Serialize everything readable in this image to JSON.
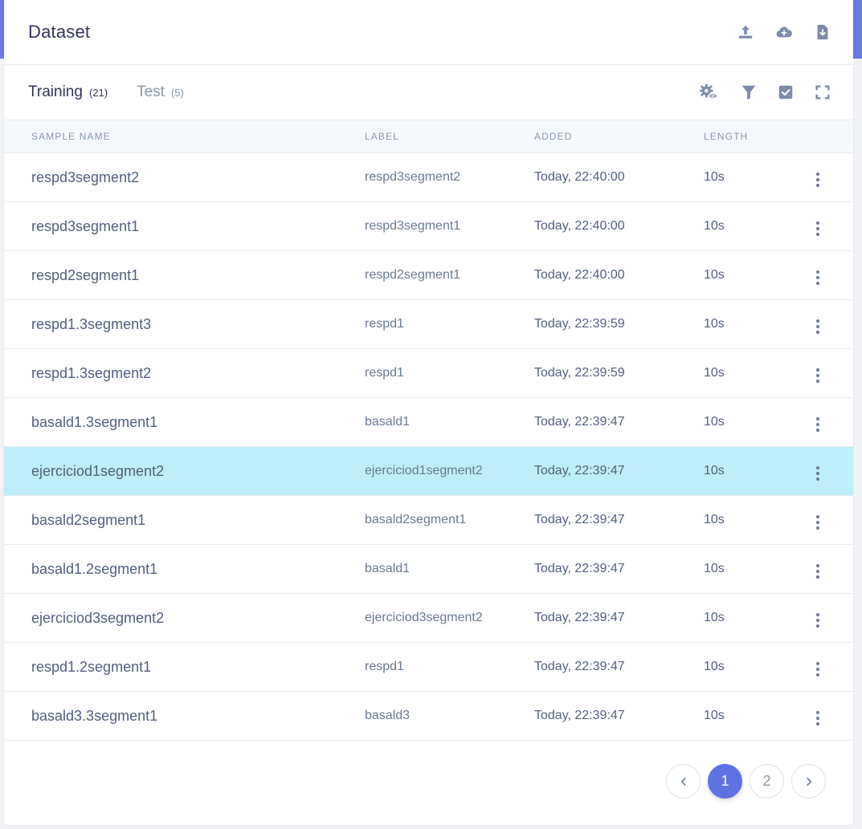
{
  "header": {
    "title": "Dataset",
    "actions": [
      {
        "icon": "upload-icon",
        "name": "upload-button"
      },
      {
        "icon": "cloud-upload-icon",
        "name": "cloud-button"
      },
      {
        "icon": "file-download-icon",
        "name": "download-button"
      }
    ]
  },
  "tabs": [
    {
      "label": "Training",
      "count": "(21)",
      "active": true
    },
    {
      "label": "Test",
      "count": "(5)",
      "active": false
    }
  ],
  "toolbar_actions": [
    {
      "icon": "gear-eye-icon",
      "name": "view-settings-button"
    },
    {
      "icon": "filter-icon",
      "name": "filter-button"
    },
    {
      "icon": "checkbox-icon",
      "name": "select-button"
    },
    {
      "icon": "fullscreen-icon",
      "name": "fullscreen-button"
    }
  ],
  "table": {
    "columns": [
      "SAMPLE NAME",
      "LABEL",
      "ADDED",
      "LENGTH"
    ],
    "rows": [
      {
        "name": "respd3segment2",
        "label": "respd3segment2",
        "added": "Today, 22:40:00",
        "length": "10s",
        "selected": false
      },
      {
        "name": "respd3segment1",
        "label": "respd3segment1",
        "added": "Today, 22:40:00",
        "length": "10s",
        "selected": false
      },
      {
        "name": "respd2segment1",
        "label": "respd2segment1",
        "added": "Today, 22:40:00",
        "length": "10s",
        "selected": false
      },
      {
        "name": "respd1.3segment3",
        "label": "respd1",
        "added": "Today, 22:39:59",
        "length": "10s",
        "selected": false
      },
      {
        "name": "respd1.3segment2",
        "label": "respd1",
        "added": "Today, 22:39:59",
        "length": "10s",
        "selected": false
      },
      {
        "name": "basald1.3segment1",
        "label": "basald1",
        "added": "Today, 22:39:47",
        "length": "10s",
        "selected": false
      },
      {
        "name": "ejerciciod1segment2",
        "label": "ejerciciod1segment2",
        "added": "Today, 22:39:47",
        "length": "10s",
        "selected": true
      },
      {
        "name": "basald2segment1",
        "label": "basald2segment1",
        "added": "Today, 22:39:47",
        "length": "10s",
        "selected": false
      },
      {
        "name": "basald1.2segment1",
        "label": "basald1",
        "added": "Today, 22:39:47",
        "length": "10s",
        "selected": false
      },
      {
        "name": "ejerciciod3segment2",
        "label": "ejerciciod3segment2",
        "added": "Today, 22:39:47",
        "length": "10s",
        "selected": false
      },
      {
        "name": "respd1.2segment1",
        "label": "respd1",
        "added": "Today, 22:39:47",
        "length": "10s",
        "selected": false
      },
      {
        "name": "basald3.3segment1",
        "label": "basald3",
        "added": "Today, 22:39:47",
        "length": "10s",
        "selected": false
      }
    ]
  },
  "pagination": {
    "pages": [
      "1",
      "2"
    ],
    "current": "1"
  },
  "colors": {
    "accent": "#5e72e4",
    "selected_row": "#bdeef9",
    "icon": "#7c8ba8"
  }
}
